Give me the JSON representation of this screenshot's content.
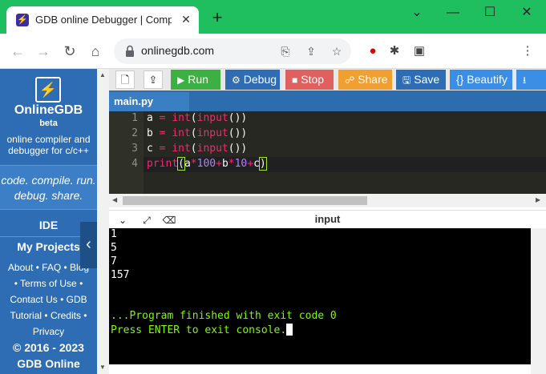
{
  "browser": {
    "tab_title": "GDB online Debugger | Compile",
    "tab_close": "✕",
    "new_tab": "+",
    "url": "onlinegdb.com",
    "win_minimize": "⌄",
    "win_restore": "—",
    "win_maximize": "☐",
    "win_close": "✕"
  },
  "sidebar": {
    "brand": "OnlineGDB",
    "beta": "beta",
    "description": "online compiler and debugger for c/c++",
    "motto_line1": "code. compile. run.",
    "motto_line2": "debug. share.",
    "ide": "IDE",
    "my_projects": "My Projects",
    "link_about": "About",
    "link_faq": "FAQ",
    "link_blog": "Blog",
    "link_terms": "Terms of Use",
    "link_contact": "Contact Us",
    "link_gdb": "GDB",
    "link_tutorial": "Tutorial",
    "link_credits": "Credits",
    "link_privacy": "Privacy",
    "copyright": "© 2016 - 2023",
    "company": "GDB Online"
  },
  "toolbar": {
    "run": "Run",
    "debug": "Debug",
    "stop": "Stop",
    "share": "Share",
    "save": "Save",
    "beautify": "{} Beautify",
    "colors": {
      "run": "#3cb043",
      "debug": "#2e6db4",
      "stop": "#e06060",
      "share": "#f0a030",
      "save": "#2e6db4",
      "beautify": "#3a8ee6"
    }
  },
  "editor": {
    "filename": "main.py",
    "line_numbers": [
      "1",
      "2",
      "3",
      "4"
    ]
  },
  "console": {
    "title": "input",
    "lines": [
      "1",
      "5",
      "7",
      "157"
    ],
    "finished": "...Program finished with exit code 0",
    "press_enter": "Press ENTER to exit console."
  }
}
